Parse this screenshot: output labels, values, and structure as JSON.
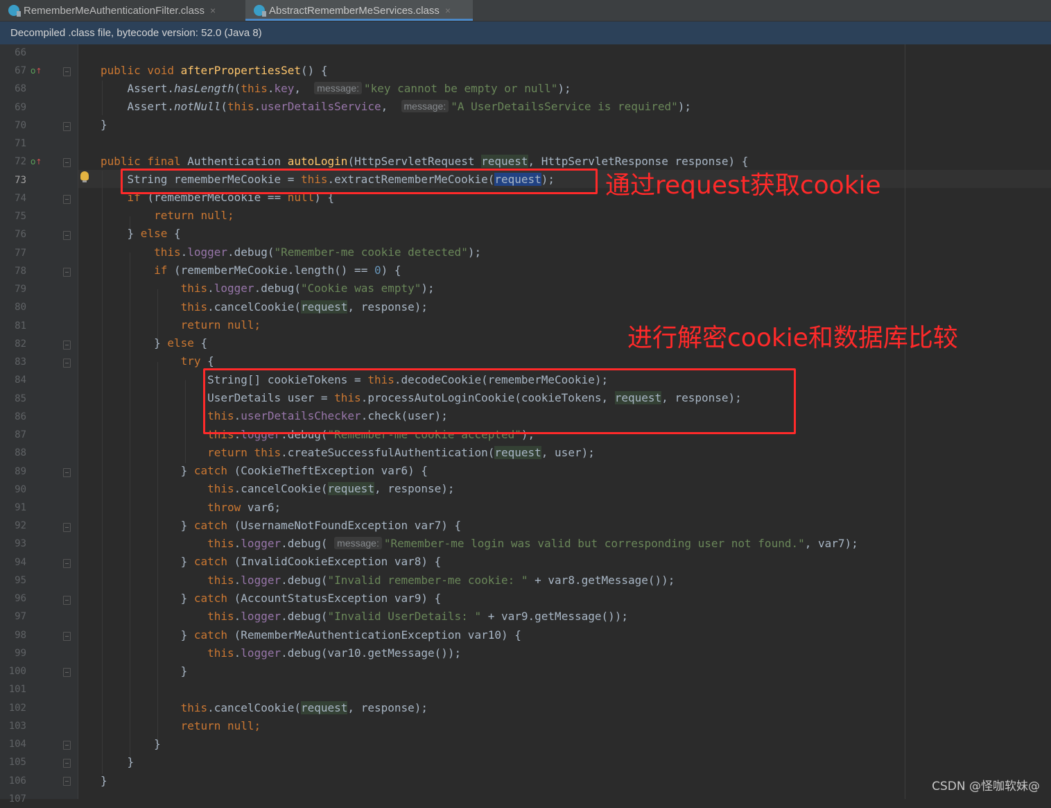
{
  "tabs": [
    {
      "label": "RememberMeAuthenticationFilter.class",
      "active": false,
      "close": "×"
    },
    {
      "label": "AbstractRememberMeServices.class",
      "active": true,
      "close": "×"
    }
  ],
  "banner": "Decompiled .class file, bytecode version: 52.0 (Java 8)",
  "current_line": "73",
  "line_numbers": [
    "66",
    "67",
    "68",
    "69",
    "70",
    "71",
    "72",
    "73",
    "74",
    "75",
    "76",
    "77",
    "78",
    "79",
    "80",
    "81",
    "82",
    "83",
    "84",
    "85",
    "86",
    "87",
    "88",
    "89",
    "90",
    "91",
    "92",
    "93",
    "94",
    "95",
    "96",
    "97",
    "98",
    "99",
    "100",
    "101",
    "102",
    "103",
    "104",
    "105",
    "106",
    "107"
  ],
  "hints": {
    "message": "message:"
  },
  "annotations": {
    "first": "通过request获取cookie",
    "second": "进行解密cookie和数据库比较"
  },
  "watermark": "CSDN @怪咖软妹@",
  "colors": {
    "editor_bg": "#2b2b2b",
    "keyword": "#cc7832",
    "method": "#ffc66d",
    "field": "#9876aa",
    "string": "#6a8759",
    "number": "#6897bb",
    "annotation_red": "#ff2a2a"
  }
}
